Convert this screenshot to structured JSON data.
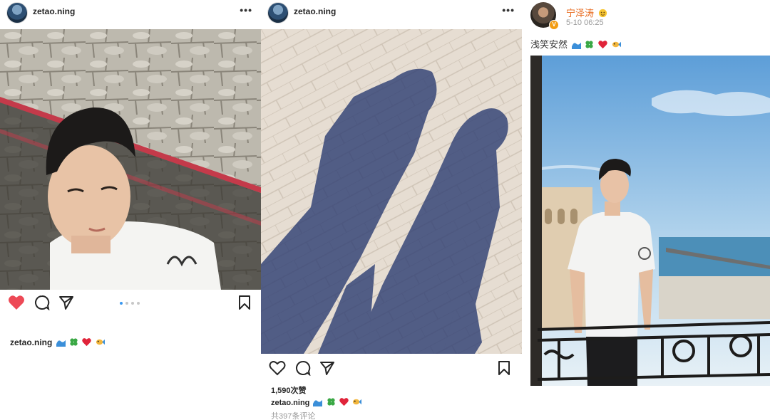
{
  "instagram_post_1": {
    "username": "zetao.ning",
    "caption_user": "zetao.ning",
    "caption_emojis": [
      "wave-emoji",
      "clover-emoji",
      "heart-emoji",
      "fish-emoji"
    ],
    "liked": true,
    "carousel": {
      "count": 4,
      "active": 1
    }
  },
  "instagram_post_2": {
    "username": "zetao.ning",
    "likes": "1,590次赞",
    "caption_user": "zetao.ning",
    "caption_emojis": [
      "wave-emoji",
      "clover-emoji",
      "heart-emoji",
      "fish-emoji"
    ],
    "comments": "共397条评论"
  },
  "weibo_post": {
    "name": "宁泽涛",
    "name_emoji": "face-emoji",
    "verified_badge": "V",
    "time": "5-10 06:25",
    "text": "浅笑安然",
    "text_emojis": [
      "wave-emoji",
      "clover-emoji",
      "heart-emoji",
      "fish-emoji"
    ]
  },
  "colors": {
    "like_red": "#ed4956",
    "weibo_orange": "#e86b1f",
    "carousel_active": "#3897f0"
  }
}
